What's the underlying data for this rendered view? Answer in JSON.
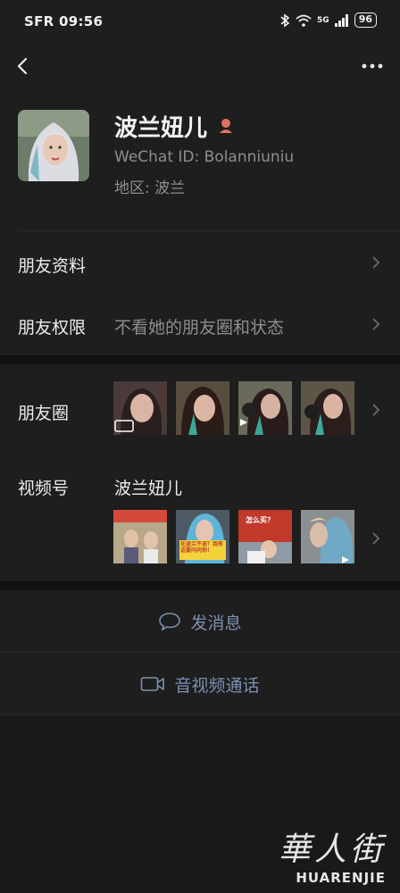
{
  "status_bar": {
    "carrier_time": "SFR 09:56",
    "network": "5G",
    "battery": "96"
  },
  "profile": {
    "name": "波兰妞儿",
    "wechat_id": "WeChat ID:  Bolanniuniu",
    "region": "地区:  波兰"
  },
  "rows": {
    "friend_info": "朋友资料",
    "friend_permissions": "朋友权限",
    "permissions_value": "不看她的朋友圈和状态",
    "moments": "朋友圈",
    "channels": "视频号",
    "channels_name": "波兰妞儿"
  },
  "channel_thumbs": {
    "thumb2_text": "在波兰不说？我有话要问问你！",
    "thumb3_text": "怎么买？"
  },
  "actions": {
    "send_message": "发消息",
    "video_call": "音视频通话"
  },
  "watermark": {
    "cn": "華人街",
    "en": "HUARENJIE"
  },
  "icons": {
    "back": "back-arrow-icon",
    "more": "more-dots-icon",
    "gender": "female-icon",
    "chat": "chat-bubble-icon",
    "video": "video-camera-icon"
  }
}
